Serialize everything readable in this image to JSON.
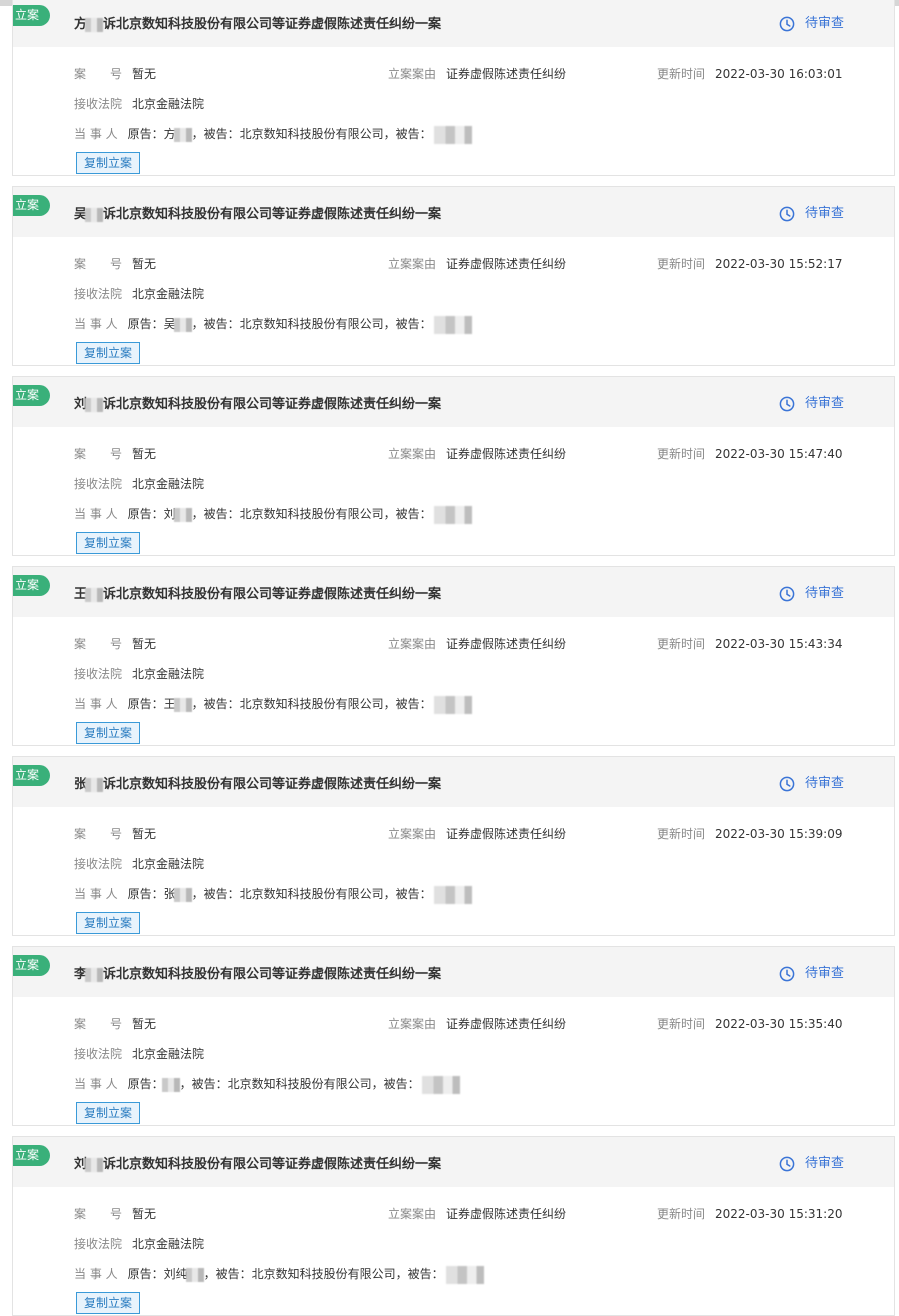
{
  "status_label": "待审查",
  "labels": {
    "case_no": "案　　号",
    "cause": "立案案由",
    "updated": "更新时间",
    "court": "接收法院",
    "parties": "当 事 人"
  },
  "copy_label": "复制立案",
  "cases": [
    {
      "tag": "立案",
      "title_pre": "方",
      "title_rest": "诉北京数知科技股份有限公司等证券虚假陈述责任纠纷一案",
      "case_no": "暂无",
      "cause": "证券虚假陈述责任纠纷",
      "updated": "2022-03-30 16:03:01",
      "court": "北京金融法院",
      "parties_pre": "原告：方",
      "parties_mid": "，被告：北京数知科技股份有限公司，被告："
    },
    {
      "tag": "立案",
      "title_pre": "吴",
      "title_rest": "诉北京数知科技股份有限公司等证券虚假陈述责任纠纷一案",
      "case_no": "暂无",
      "cause": "证券虚假陈述责任纠纷",
      "updated": "2022-03-30 15:52:17",
      "court": "北京金融法院",
      "parties_pre": "原告：吴",
      "parties_mid": "，被告：北京数知科技股份有限公司，被告："
    },
    {
      "tag": "立案",
      "title_pre": "刘",
      "title_rest": "诉北京数知科技股份有限公司等证券虚假陈述责任纠纷一案",
      "case_no": "暂无",
      "cause": "证券虚假陈述责任纠纷",
      "updated": "2022-03-30 15:47:40",
      "court": "北京金融法院",
      "parties_pre": "原告：刘",
      "parties_mid": "，被告：北京数知科技股份有限公司，被告："
    },
    {
      "tag": "立案",
      "title_pre": "王",
      "title_rest": "诉北京数知科技股份有限公司等证券虚假陈述责任纠纷一案",
      "case_no": "暂无",
      "cause": "证券虚假陈述责任纠纷",
      "updated": "2022-03-30 15:43:34",
      "court": "北京金融法院",
      "parties_pre": "原告：王",
      "parties_mid": "，被告：北京数知科技股份有限公司，被告："
    },
    {
      "tag": "立案",
      "title_pre": "张",
      "title_rest": "诉北京数知科技股份有限公司等证券虚假陈述责任纠纷一案",
      "case_no": "暂无",
      "cause": "证券虚假陈述责任纠纷",
      "updated": "2022-03-30 15:39:09",
      "court": "北京金融法院",
      "parties_pre": "原告：张",
      "parties_mid": "，被告：北京数知科技股份有限公司，被告："
    },
    {
      "tag": "立案",
      "title_pre": "李",
      "title_rest": "诉北京数知科技股份有限公司等证券虚假陈述责任纠纷一案",
      "case_no": "暂无",
      "cause": "证券虚假陈述责任纠纷",
      "updated": "2022-03-30 15:35:40",
      "court": "北京金融法院",
      "parties_pre": "原告：",
      "parties_mid": "，被告：北京数知科技股份有限公司，被告："
    },
    {
      "tag": "立案",
      "title_pre": "刘",
      "title_rest": "诉北京数知科技股份有限公司等证券虚假陈述责任纠纷一案",
      "case_no": "暂无",
      "cause": "证券虚假陈述责任纠纷",
      "updated": "2022-03-30 15:31:20",
      "court": "北京金融法院",
      "parties_pre": "原告：刘纯",
      "parties_mid": "，被告：北京数知科技股份有限公司，被告："
    }
  ]
}
